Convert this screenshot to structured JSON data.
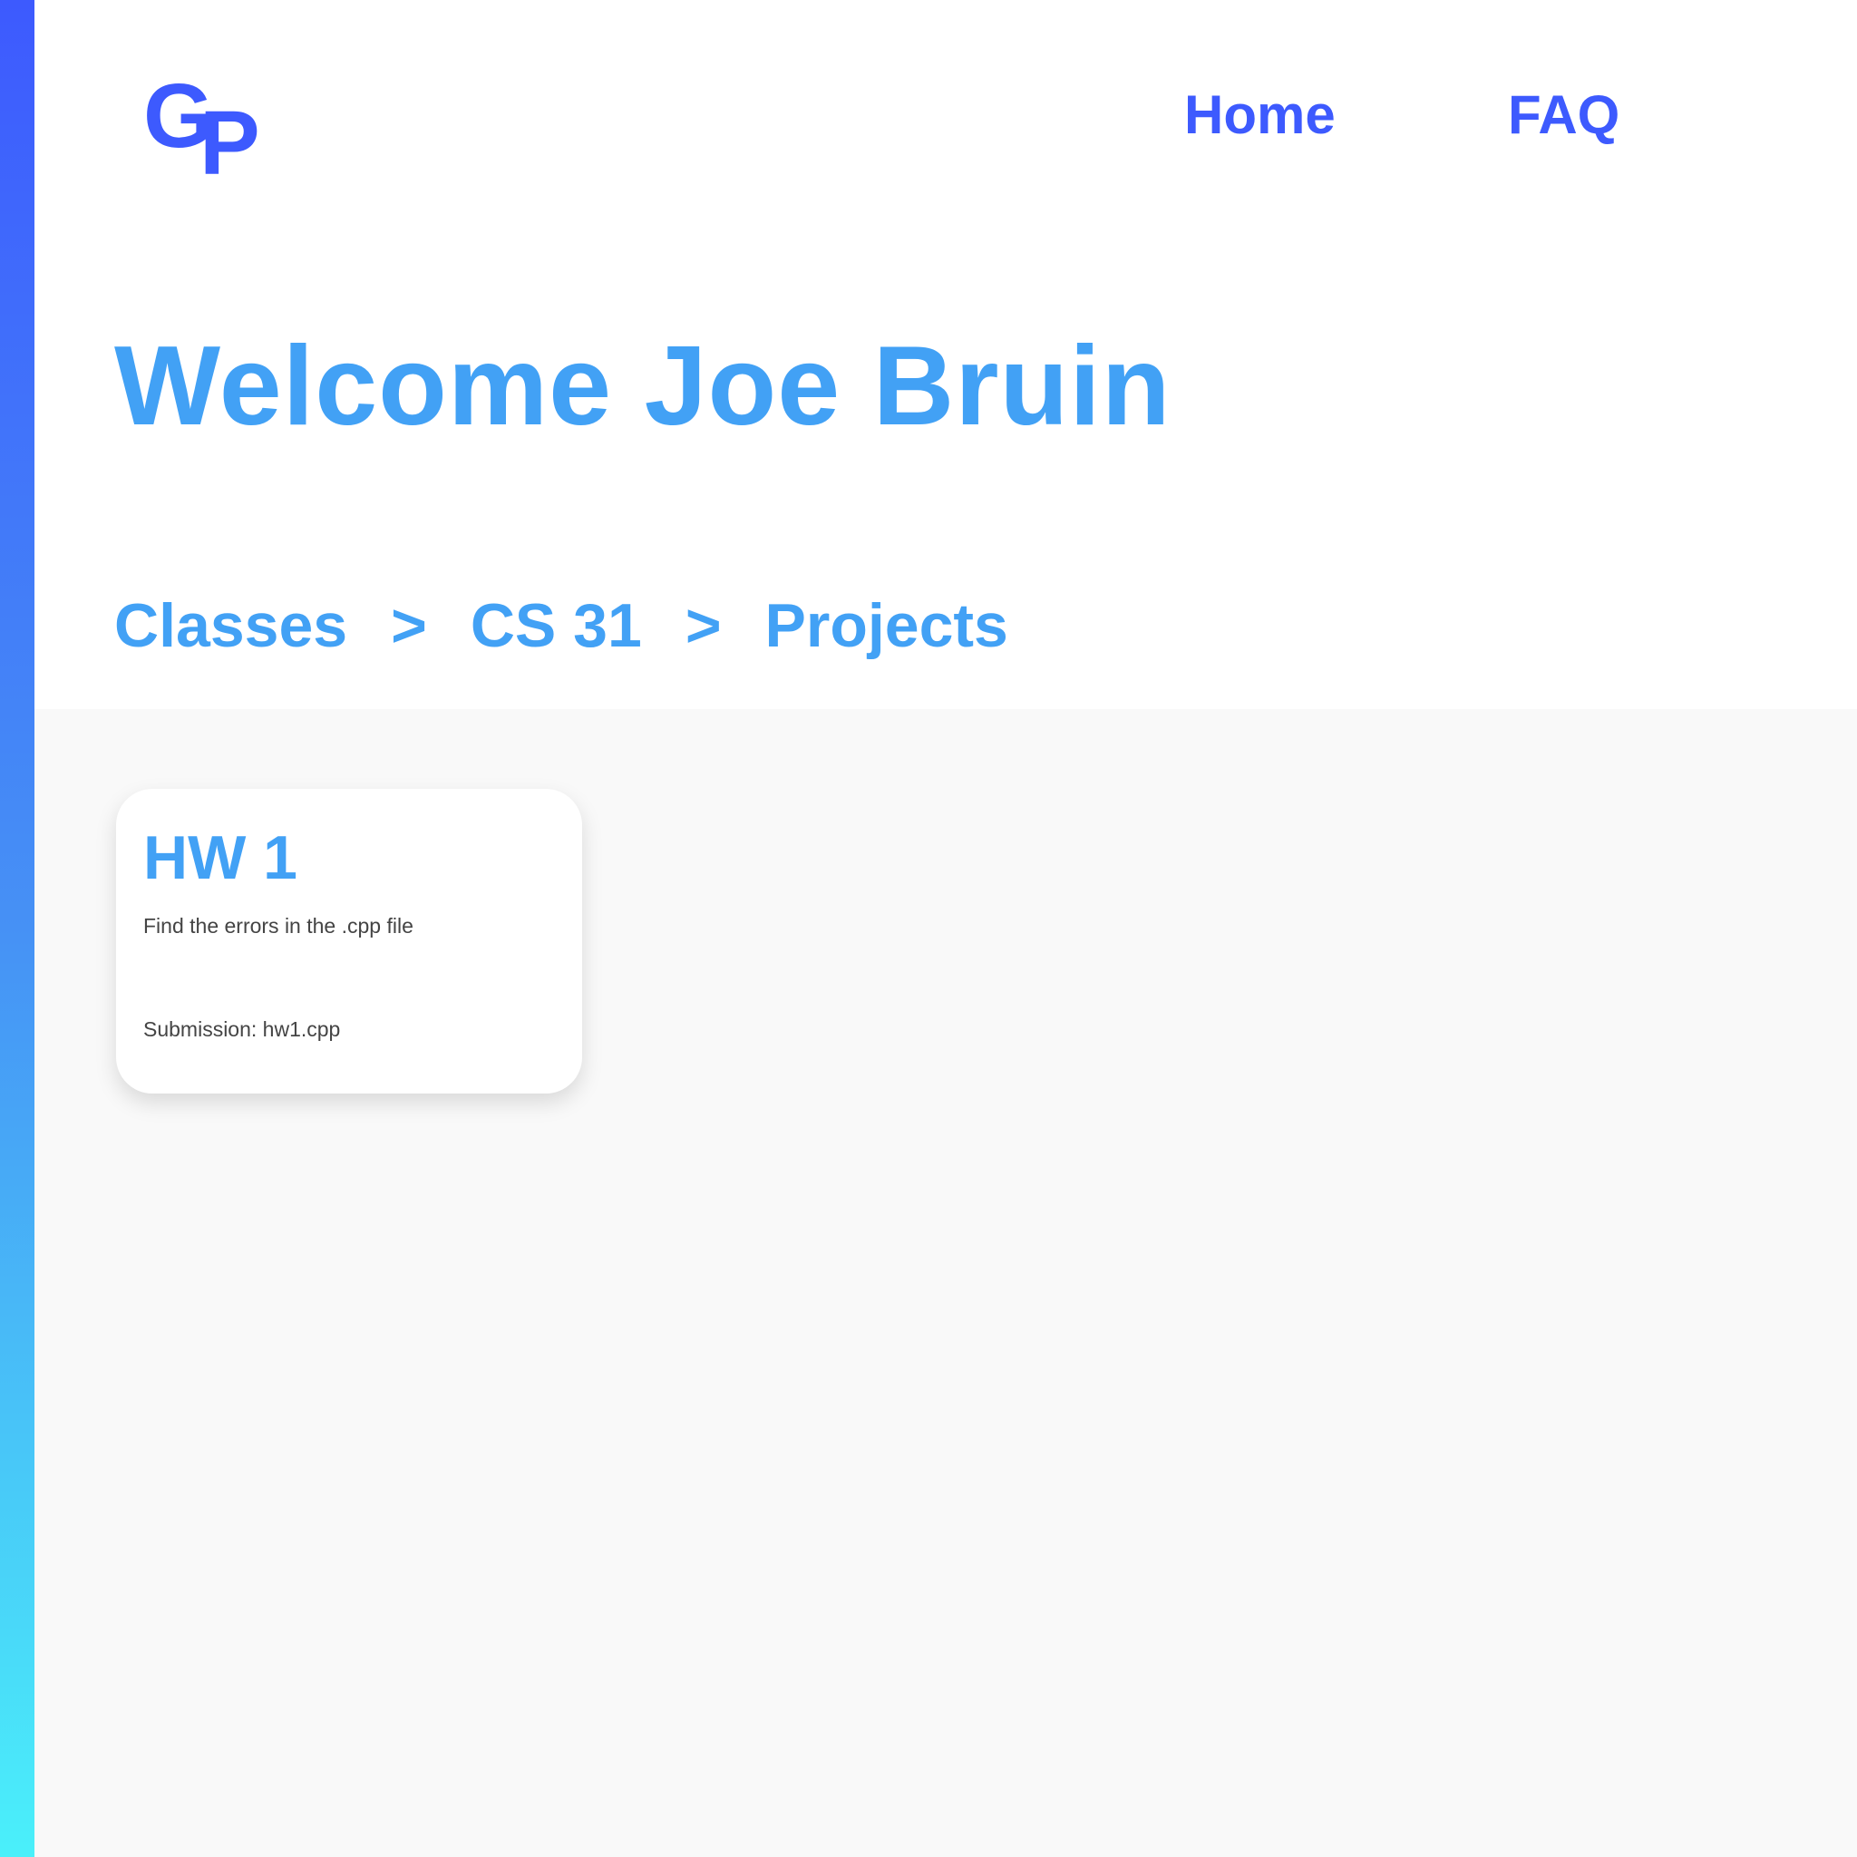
{
  "brand": {
    "logo_g": "G",
    "logo_p": "P",
    "accent_color": "#3d5afe",
    "heading_color": "#42a1f5"
  },
  "nav": {
    "home_label": "Home",
    "faq_label": "FAQ"
  },
  "welcome": {
    "text": "Welcome Joe Bruin"
  },
  "breadcrumb": {
    "items": [
      "Classes",
      "CS 31",
      "Projects"
    ],
    "separator": ">"
  },
  "projects": [
    {
      "title": "HW 1",
      "description": "Find the errors in the .cpp file",
      "submission": "Submission: hw1.cpp"
    }
  ]
}
